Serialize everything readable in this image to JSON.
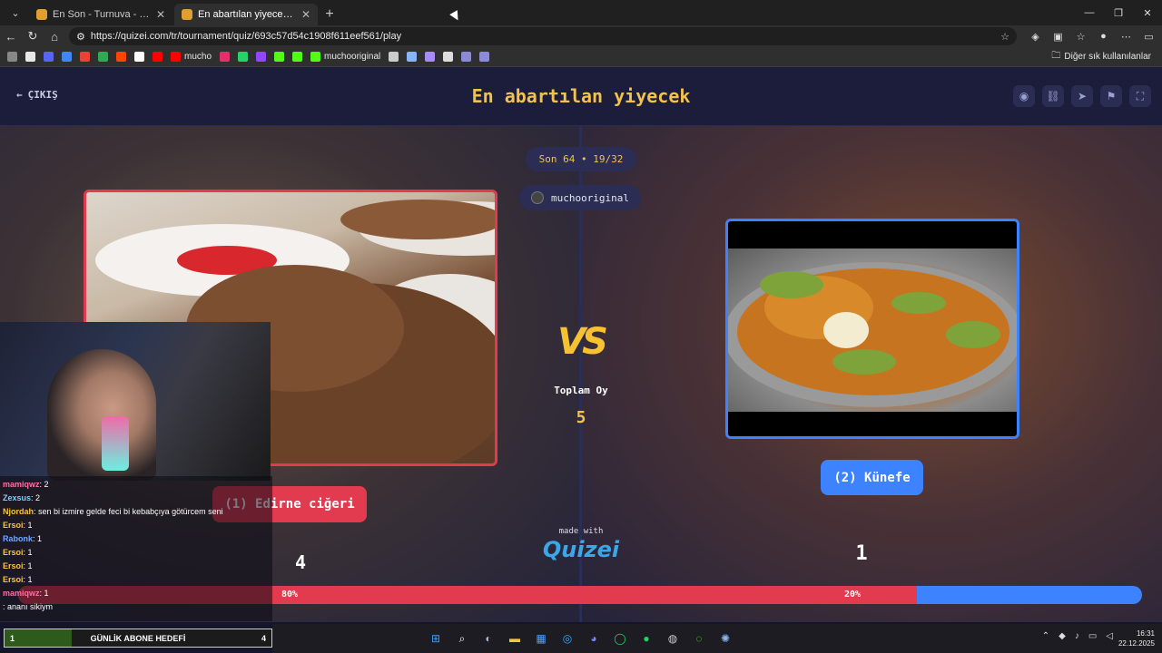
{
  "browser": {
    "tabs": [
      {
        "title": "En Son - Turnuva - Quizei",
        "active": false
      },
      {
        "title": "En abartılan yiyecek - Tier List, Kör",
        "active": true
      }
    ],
    "url": "https://quizei.com/tr/tournament/quiz/693c57d54c1908f611eef561/play",
    "bookmarks": [
      {
        "label": "",
        "color": "#888888"
      },
      {
        "label": "",
        "color": "#e8e8e8"
      },
      {
        "label": "",
        "color": "#5865f2"
      },
      {
        "label": "",
        "color": "#4285f4"
      },
      {
        "label": "",
        "color": "#ea4335"
      },
      {
        "label": "",
        "color": "#34a853"
      },
      {
        "label": "",
        "color": "#ff4500"
      },
      {
        "label": "",
        "color": "#ffffff"
      },
      {
        "label": "",
        "color": "#ff0000"
      },
      {
        "label": "mucho",
        "color": "#ff0000"
      },
      {
        "label": "",
        "color": "#e1306c"
      },
      {
        "label": "",
        "color": "#25d366"
      },
      {
        "label": "",
        "color": "#9146ff"
      },
      {
        "label": "",
        "color": "#53fc18"
      },
      {
        "label": "",
        "color": "#53fc18"
      },
      {
        "label": "muchooriginal",
        "color": "#53fc18"
      },
      {
        "label": "",
        "color": "#cccccc"
      },
      {
        "label": "",
        "color": "#8ab4f8"
      },
      {
        "label": "",
        "color": "#a78bfa"
      },
      {
        "label": "",
        "color": "#dddddd"
      },
      {
        "label": "",
        "color": "#8b8bd6"
      },
      {
        "label": "",
        "color": "#8b8bd6"
      }
    ],
    "other_bookmarks": "Diğer sık kullanılanlar"
  },
  "quiz": {
    "exit_label": "ÇIKIŞ",
    "title": "En abartılan yiyecek",
    "round_info": "Son 64 • 19/32",
    "author": "muchooriginal",
    "vs_label": "VS",
    "total_votes_label": "Toplam Oy",
    "total_votes": "5",
    "left_option": "(1) Edirne ciğeri",
    "right_option": "(2) Künefe",
    "left_votes": "4",
    "right_votes": "1",
    "left_percent_label": "80%",
    "right_percent_label": "20%",
    "left_share": 0.8,
    "made_with": "made with",
    "brand": "Quizei",
    "colors": {
      "left": "#e23a4e",
      "right": "#3d82ff",
      "accent": "#f2c14e"
    }
  },
  "chat": [
    {
      "user": "mamiqwz",
      "msg": ": 2",
      "color": "#ff6fa8"
    },
    {
      "user": "Zexsus",
      "msg": ": 2",
      "color": "#6fd6ff"
    },
    {
      "user": "Njordah",
      "msg": ": sen bi izmire gelde feci bi kebabçıya götürcem seni",
      "color": "#f5c542"
    },
    {
      "user": "Ersoi",
      "msg": ": 1",
      "color": "#f5c542"
    },
    {
      "user": "Rabonk",
      "msg": ": 1",
      "color": "#6fa8ff"
    },
    {
      "user": "Ersoi",
      "msg": ": 1",
      "color": "#f5c542"
    },
    {
      "user": "Ersoi",
      "msg": ": 1",
      "color": "#f5c542"
    },
    {
      "user": "Ersoi",
      "msg": ": 1",
      "color": "#f5c542"
    },
    {
      "user": "mamiqwz",
      "msg": ": 1",
      "color": "#ff6fa8"
    },
    {
      "user": "",
      "msg": ": ananı sikiym",
      "color": "#6fa8ff"
    }
  ],
  "goal": {
    "current": "1",
    "label": "GÜNLİK ABONE HEDEFİ",
    "target": "4",
    "progress": 0.25
  },
  "taskbar": {
    "time": "16:31",
    "date": "22.12.2025"
  }
}
